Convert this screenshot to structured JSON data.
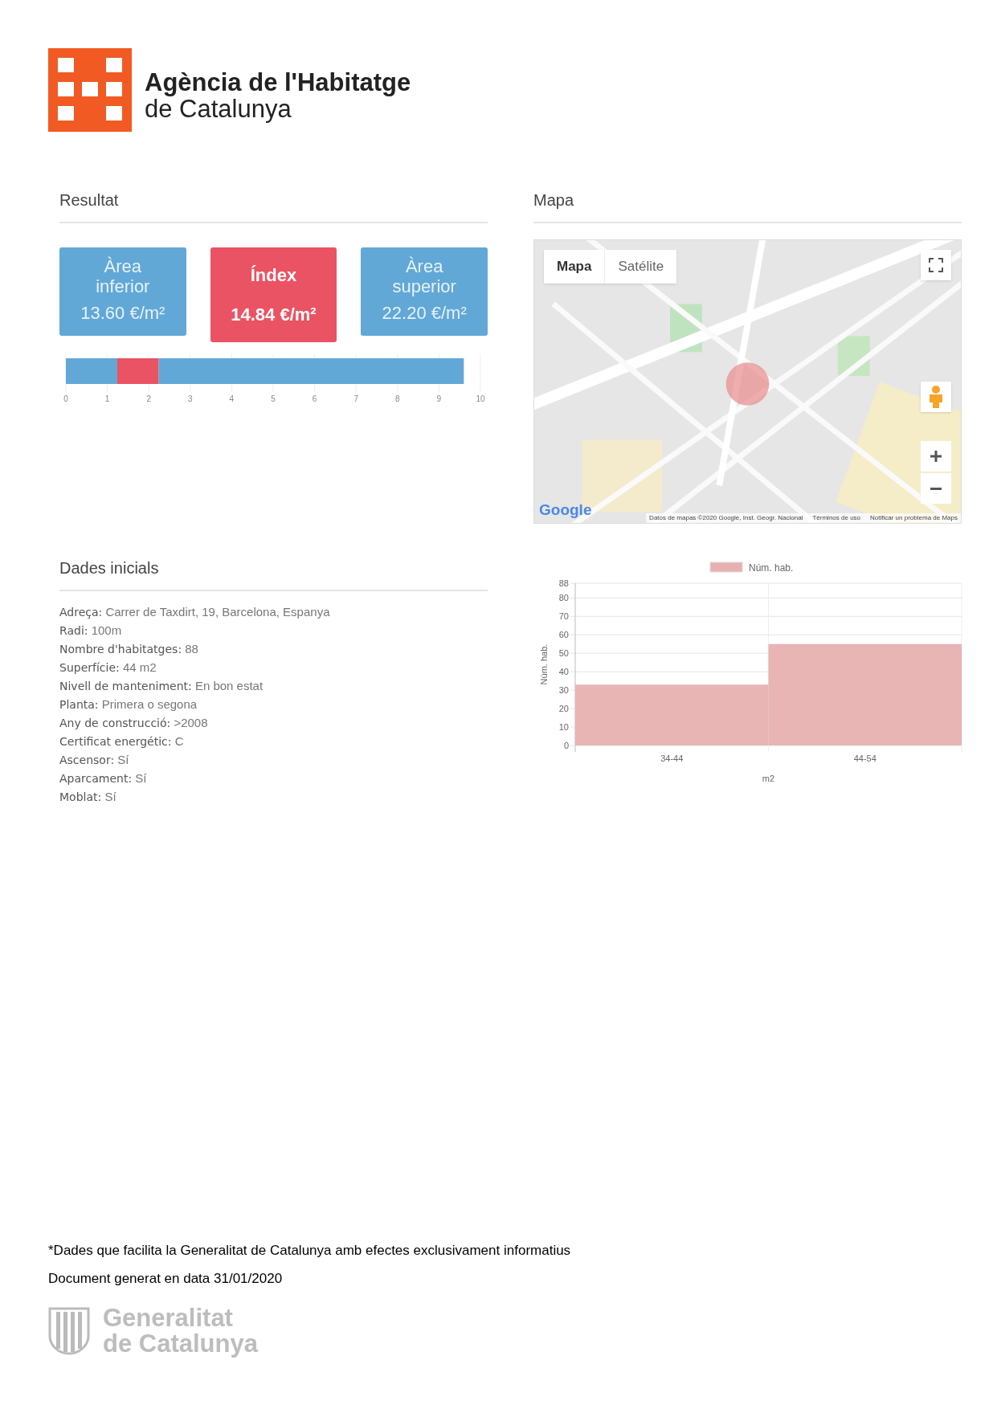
{
  "logo": {
    "line1": "Agència de l'Habitatge",
    "line2": "de Catalunya"
  },
  "result": {
    "title": "Resultat",
    "cards": [
      {
        "kind": "range",
        "label": "Àrea inferior",
        "value": "13.60 €/m²"
      },
      {
        "kind": "index",
        "label": "Índex",
        "value": "14.84 €/m²"
      },
      {
        "kind": "range",
        "label": "Àrea superior",
        "value": "22.20 €/m²"
      }
    ],
    "chart_data": {
      "type": "bar",
      "orientation": "horizontal",
      "stacked": true,
      "grid": true,
      "xlim": [
        0,
        10
      ],
      "xticks": [
        0,
        1,
        2,
        3,
        4,
        5,
        6,
        7,
        8,
        9,
        10
      ],
      "series": [
        {
          "color": "#62a8d7",
          "values": [
            1.24
          ]
        },
        {
          "color": "#ea5363",
          "values": [
            1.0
          ]
        },
        {
          "color": "#62a8d7",
          "values": [
            7.36
          ]
        }
      ]
    }
  },
  "map": {
    "title": "Mapa",
    "map_types": [
      {
        "label": "Mapa",
        "selected": true
      },
      {
        "label": "Satélite",
        "selected": false
      }
    ],
    "logo": "Google",
    "attribution": [
      "Datos de mapas ©2020 Google, Inst. Geogr. Nacional",
      "Términos de uso",
      "Notificar un problema de Maps"
    ]
  },
  "initial_data": {
    "title": "Dades inicials",
    "fields": [
      {
        "label": "Adreça:",
        "value": "Carrer de Taxdirt, 19, Barcelona, Espanya"
      },
      {
        "label": "Radi:",
        "value": "100m"
      },
      {
        "label": "Nombre d'habitatges:",
        "value": "88"
      },
      {
        "label": "Superfície:",
        "value": "44 m2"
      },
      {
        "label": "Nivell de manteniment:",
        "value": "En bon estat"
      },
      {
        "label": "Planta:",
        "value": "Primera o segona"
      },
      {
        "label": "Any de construcció:",
        "value": ">2008"
      },
      {
        "label": "Certificat energétic:",
        "value": "C"
      },
      {
        "label": "Ascensor:",
        "value": "Sí"
      },
      {
        "label": "Aparcament:",
        "value": "Sí"
      },
      {
        "label": "Moblat:",
        "value": "Sí"
      }
    ]
  },
  "histogram": {
    "chart_data": {
      "type": "bar",
      "grid": true,
      "xlabel": "m2",
      "ylabel": "Núm. hab.",
      "categories": [
        "34-44",
        "44-54"
      ],
      "ylim": [
        0,
        88
      ],
      "yticks": [
        0,
        10,
        20,
        30,
        40,
        50,
        60,
        70,
        80,
        88
      ],
      "series": [
        {
          "name": "Núm. hab.",
          "color": "#e8b0b0",
          "values": [
            33,
            55
          ]
        }
      ]
    }
  },
  "footer": {
    "notes": [
      "*Dades que facilita la Generalitat de Catalunya amb efectes exclusivament informatius",
      "Document generat en data 31/01/2020"
    ],
    "logo": {
      "line1": "Generalitat",
      "line2": "de Catalunya"
    }
  }
}
